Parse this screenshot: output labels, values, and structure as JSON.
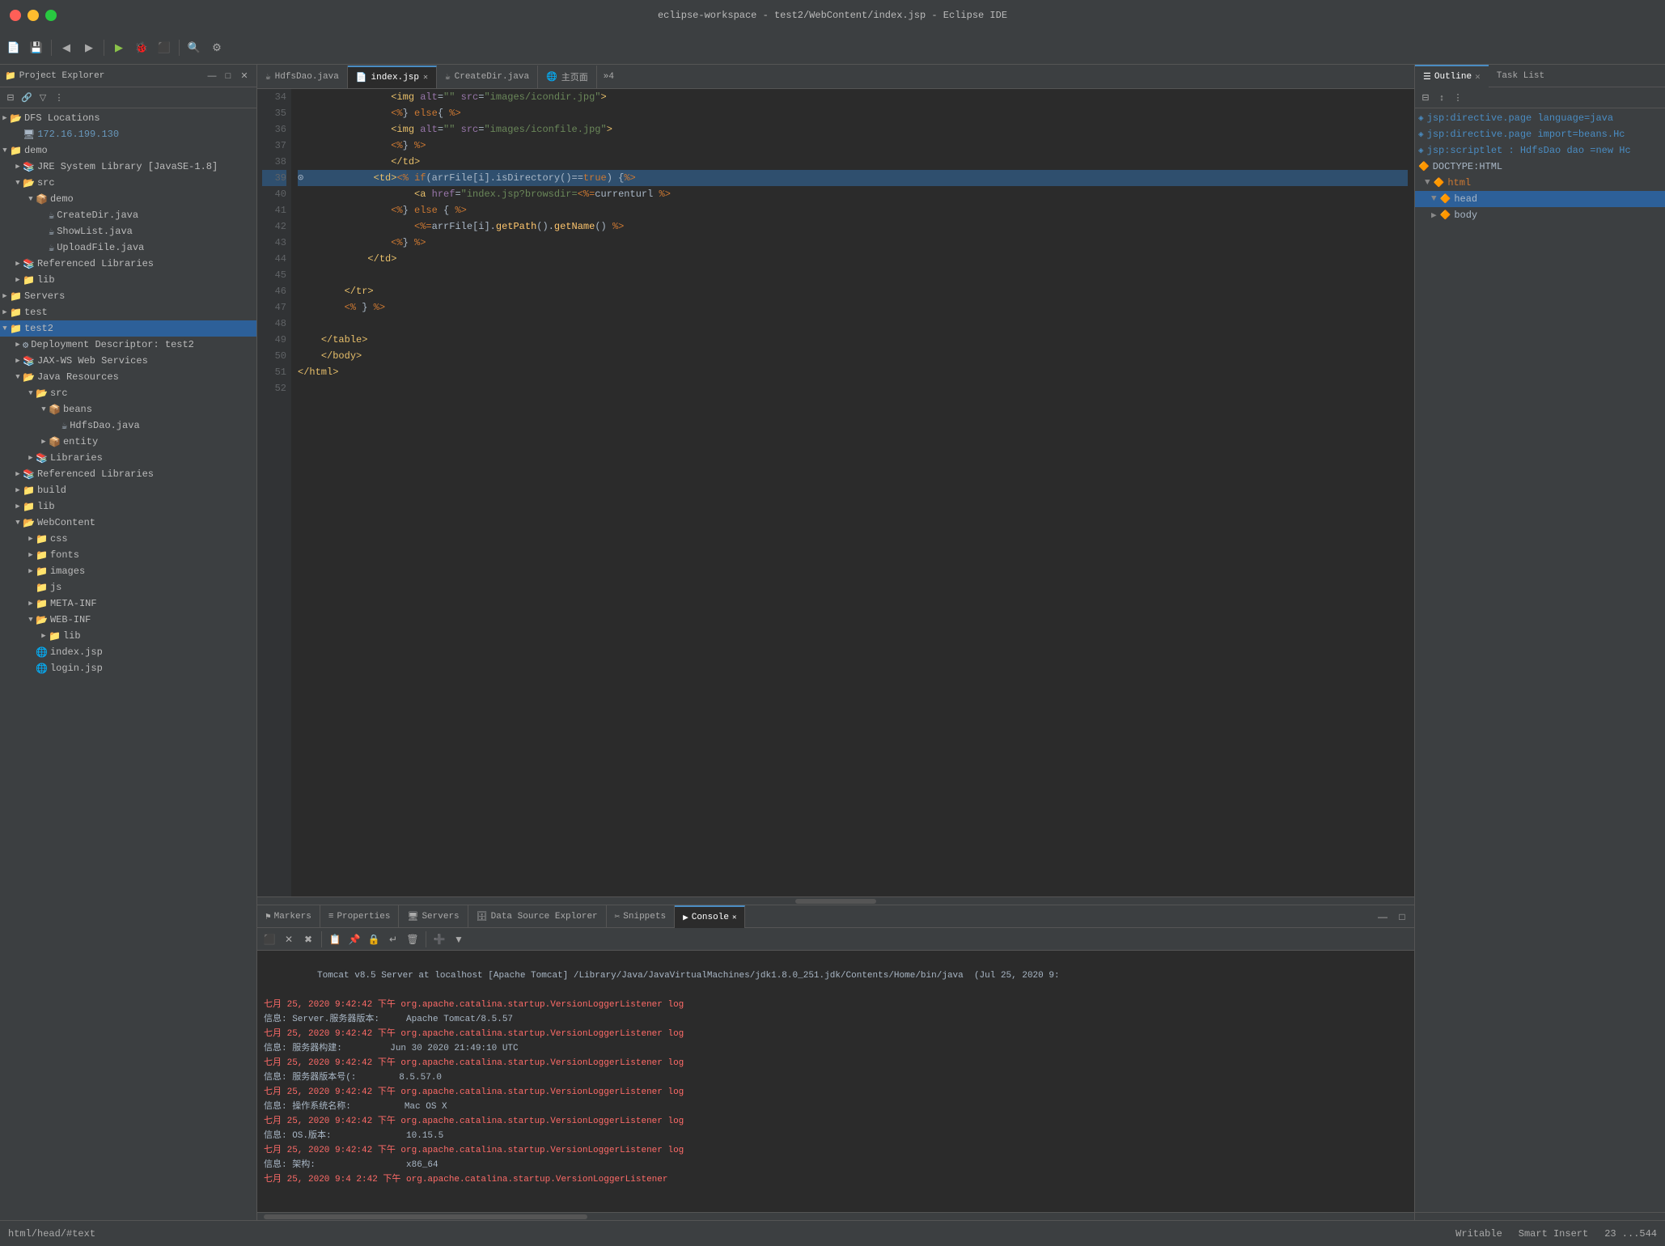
{
  "window": {
    "title": "eclipse-workspace - test2/WebContent/index.jsp - Eclipse IDE"
  },
  "title_bar": {
    "title": "eclipse-workspace - test2/WebContent/index.jsp - Eclipse IDE"
  },
  "project_explorer": {
    "title": "Project Explorer",
    "close_icon": "✕",
    "min_icon": "—",
    "max_icon": "□",
    "tree": [
      {
        "id": "dfs-locations",
        "label": "DFS Locations",
        "depth": 0,
        "type": "folder",
        "expanded": true
      },
      {
        "id": "ip-addr",
        "label": "172.16.199.130",
        "depth": 1,
        "type": "server"
      },
      {
        "id": "demo",
        "label": "demo",
        "depth": 0,
        "type": "project",
        "expanded": true
      },
      {
        "id": "jre",
        "label": "JRE System Library [JavaSE-1.8]",
        "depth": 1,
        "type": "lib"
      },
      {
        "id": "src",
        "label": "src",
        "depth": 1,
        "type": "folder",
        "expanded": true
      },
      {
        "id": "demo-pkg",
        "label": "demo",
        "depth": 2,
        "type": "package",
        "expanded": true
      },
      {
        "id": "CreateDir",
        "label": "CreateDir.java",
        "depth": 3,
        "type": "java"
      },
      {
        "id": "ShowList",
        "label": "ShowList.java",
        "depth": 3,
        "type": "java"
      },
      {
        "id": "UploadFile",
        "label": "UploadFile.java",
        "depth": 3,
        "type": "java"
      },
      {
        "id": "ref-libs-demo",
        "label": "Referenced Libraries",
        "depth": 1,
        "type": "lib"
      },
      {
        "id": "lib-demo",
        "label": "lib",
        "depth": 1,
        "type": "folder"
      },
      {
        "id": "servers",
        "label": "Servers",
        "depth": 0,
        "type": "folder"
      },
      {
        "id": "test",
        "label": "test",
        "depth": 0,
        "type": "project"
      },
      {
        "id": "test2",
        "label": "test2",
        "depth": 0,
        "type": "project",
        "expanded": true,
        "selected": true
      },
      {
        "id": "deploy-desc",
        "label": "Deployment Descriptor: test2",
        "depth": 1,
        "type": "config"
      },
      {
        "id": "jax-ws",
        "label": "JAX-WS Web Services",
        "depth": 1,
        "type": "lib"
      },
      {
        "id": "java-res",
        "label": "Java Resources",
        "depth": 1,
        "type": "folder",
        "expanded": true
      },
      {
        "id": "src2",
        "label": "src",
        "depth": 2,
        "type": "folder",
        "expanded": true
      },
      {
        "id": "beans-pkg",
        "label": "beans",
        "depth": 3,
        "type": "package",
        "expanded": true
      },
      {
        "id": "HdfsDao",
        "label": "HdfsDao.java",
        "depth": 4,
        "type": "java"
      },
      {
        "id": "entity-pkg",
        "label": "entity",
        "depth": 3,
        "type": "package"
      },
      {
        "id": "libraries",
        "label": "Libraries",
        "depth": 2,
        "type": "lib"
      },
      {
        "id": "ref-libs",
        "label": "Referenced Libraries",
        "depth": 1,
        "type": "lib"
      },
      {
        "id": "build",
        "label": "build",
        "depth": 1,
        "type": "folder"
      },
      {
        "id": "lib2",
        "label": "lib",
        "depth": 1,
        "type": "folder"
      },
      {
        "id": "WebContent",
        "label": "WebContent",
        "depth": 1,
        "type": "folder",
        "expanded": true
      },
      {
        "id": "css",
        "label": "css",
        "depth": 2,
        "type": "folder"
      },
      {
        "id": "fonts",
        "label": "fonts",
        "depth": 2,
        "type": "folder"
      },
      {
        "id": "images",
        "label": "images",
        "depth": 2,
        "type": "folder"
      },
      {
        "id": "js",
        "label": "js",
        "depth": 2,
        "type": "folder"
      },
      {
        "id": "META-INF",
        "label": "META-INF",
        "depth": 2,
        "type": "folder"
      },
      {
        "id": "WEB-INF",
        "label": "WEB-INF",
        "depth": 2,
        "type": "folder",
        "expanded": true
      },
      {
        "id": "lib3",
        "label": "lib",
        "depth": 3,
        "type": "folder"
      },
      {
        "id": "index-jsp",
        "label": "index.jsp",
        "depth": 2,
        "type": "jsp"
      },
      {
        "id": "login-jsp",
        "label": "login.jsp",
        "depth": 2,
        "type": "jsp"
      }
    ]
  },
  "editor": {
    "tabs": [
      {
        "id": "HdfsDao-tab",
        "label": "HdfsDao.java",
        "type": "java",
        "active": false
      },
      {
        "id": "index-tab",
        "label": "index.jsp",
        "type": "jsp",
        "active": true
      },
      {
        "id": "CreateDir-tab",
        "label": "CreateDir.java",
        "type": "java",
        "active": false
      },
      {
        "id": "main-page-tab",
        "label": "主页面",
        "type": "browser",
        "active": false
      }
    ],
    "tab_overflow": "»4",
    "lines": [
      {
        "num": 34,
        "content": "<img alt=\"\" src=\"images/icondir.jpg\">"
      },
      {
        "num": 35,
        "content": "<% } else{ %>"
      },
      {
        "num": 36,
        "content": "<img alt=\"\" src=\"images/iconfile.jpg\">"
      },
      {
        "num": 37,
        "content": "<% } %>"
      },
      {
        "num": 38,
        "content": "</td>"
      },
      {
        "num": 39,
        "content": "<td><% if(arrFile[i].isDirectory()==true) {%>"
      },
      {
        "num": 40,
        "content": "<a href=\"index.jsp?browsdir=<%=currenturl %>"
      },
      {
        "num": 41,
        "content": "<% } else { %>"
      },
      {
        "num": 42,
        "content": "<%=arrFile[i].getPath().getName() %>"
      },
      {
        "num": 43,
        "content": "<% } %>"
      },
      {
        "num": 44,
        "content": "</td>"
      },
      {
        "num": 45,
        "content": ""
      },
      {
        "num": 46,
        "content": "</tr>"
      },
      {
        "num": 47,
        "content": "<% } %>"
      },
      {
        "num": 48,
        "content": ""
      },
      {
        "num": 49,
        "content": "</table>"
      },
      {
        "num": 50,
        "content": "</body>"
      },
      {
        "num": 51,
        "content": "</html>"
      },
      {
        "num": 52,
        "content": ""
      }
    ]
  },
  "outline": {
    "title": "Outline",
    "task_list": "Task List",
    "items": [
      {
        "id": "directive-page-lang",
        "label": "jsp:directive.page language=java",
        "depth": 0,
        "type": "directive"
      },
      {
        "id": "directive-page-import",
        "label": "jsp:directive.page import=beans.Hc",
        "depth": 0,
        "type": "directive"
      },
      {
        "id": "scriptlet",
        "label": "jsp:scriptlet : HdfsDao dao =new Hc",
        "depth": 0,
        "type": "scriptlet"
      },
      {
        "id": "doctype",
        "label": "DOCTYPE:HTML",
        "depth": 0,
        "type": "doctype"
      },
      {
        "id": "html-node",
        "label": "html",
        "depth": 0,
        "type": "element",
        "expanded": true
      },
      {
        "id": "head-node",
        "label": "head",
        "depth": 1,
        "type": "element",
        "expanded": true
      },
      {
        "id": "body-node",
        "label": "body",
        "depth": 1,
        "type": "element"
      }
    ]
  },
  "bottom_tabs": [
    {
      "id": "markers",
      "label": "Markers",
      "active": false
    },
    {
      "id": "properties",
      "label": "Properties",
      "active": false
    },
    {
      "id": "servers",
      "label": "Servers",
      "active": false
    },
    {
      "id": "data-source-explorer",
      "label": "Data Source Explorer",
      "active": false
    },
    {
      "id": "snippets",
      "label": "Snippets",
      "active": false
    },
    {
      "id": "console",
      "label": "Console",
      "active": true
    }
  ],
  "console": {
    "header": "Tomcat v8.5 Server at localhost [Apache Tomcat] /Library/Java/JavaVirtualMachines/jdk1.8.0_251.jdk/Contents/Home/bin/java  (Jul 25, 2020 9:",
    "lines": [
      {
        "type": "red",
        "text": "七月 25, 2020 9:42:42 下午 org.apache.catalina.startup.VersionLoggerListener log"
      },
      {
        "type": "gray",
        "text": "信息: Server.服务器版本:     Apache Tomcat/8.5.57"
      },
      {
        "type": "red",
        "text": "七月 25, 2020 9:42:42 下午 org.apache.catalina.startup.VersionLoggerListener log"
      },
      {
        "type": "gray",
        "text": "信息: 服务器构建:         Jun 30 2020 21:49:10 UTC"
      },
      {
        "type": "red",
        "text": "七月 25, 2020 9:42:42 下午 org.apache.catalina.startup.VersionLoggerListener log"
      },
      {
        "type": "gray",
        "text": "信息: 服务器版本号(:        8.5.57.0"
      },
      {
        "type": "red",
        "text": "七月 25, 2020 9:42:42 下午 org.apache.catalina.startup.VersionLoggerListener log"
      },
      {
        "type": "gray",
        "text": "信息: 操作系统名称:          Mac OS X"
      },
      {
        "type": "red",
        "text": "七月 25, 2020 9:42:42 下午 org.apache.catalina.startup.VersionLoggerListener log"
      },
      {
        "type": "gray",
        "text": "信息: OS.版本:              10.15.5"
      },
      {
        "type": "red",
        "text": "七月 25, 2020 9:42:42 下午 org.apache.catalina.startup.VersionLoggerListener log"
      },
      {
        "type": "gray",
        "text": "信息: 架构:                 x86_64"
      },
      {
        "type": "red",
        "text": "七月 25, 2020 9:4 2:42 下午 org.apache.catalina.startup.VersionLoggerListener"
      }
    ]
  },
  "status_bar": {
    "path": "html/head/#text",
    "writable": "Writable",
    "insert_mode": "Smart Insert",
    "position": "23 ...544"
  }
}
